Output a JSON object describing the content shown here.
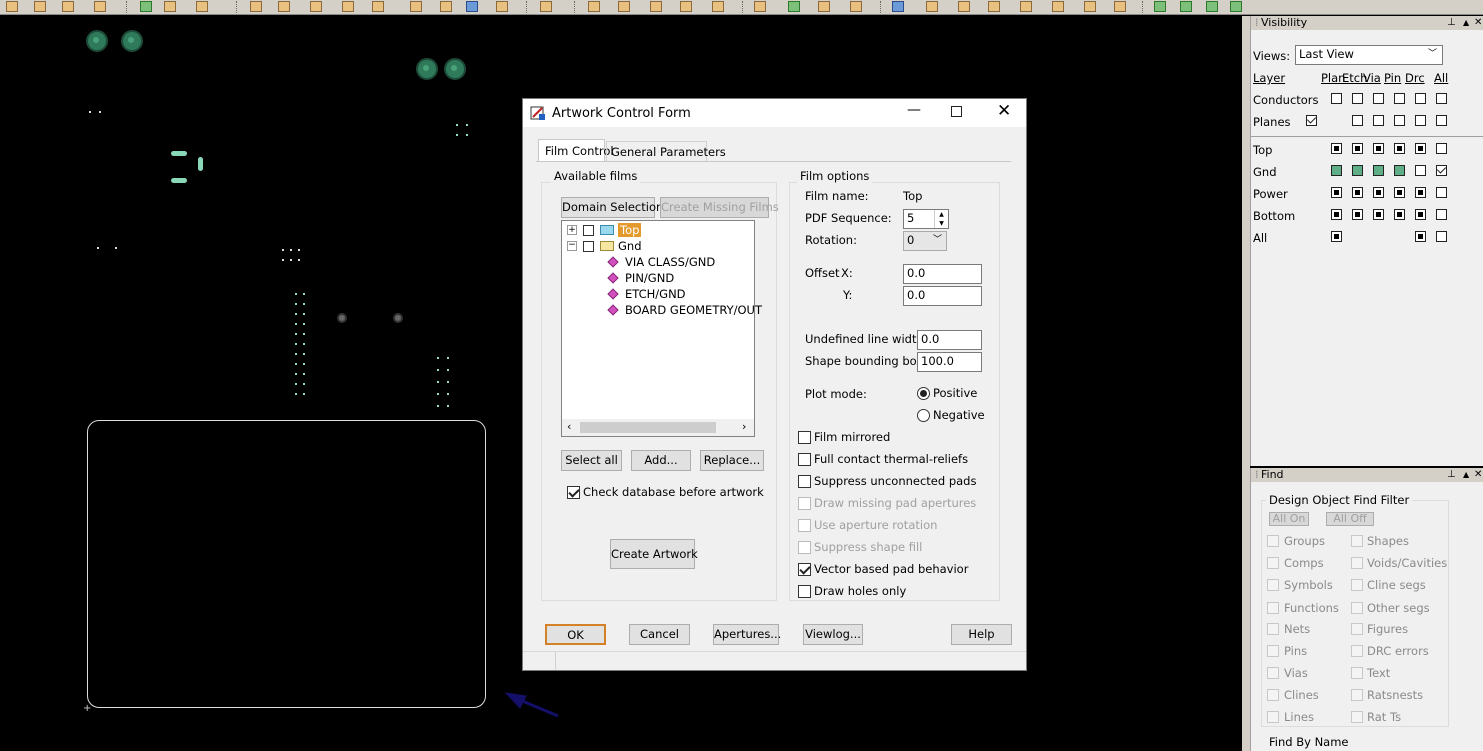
{
  "dialog": {
    "title": "Artwork Control Form",
    "tabs": [
      "Film Control",
      "General Parameters"
    ],
    "available_films_label": "Available films",
    "domain_selection": "Domain Selection",
    "create_missing_films": "Create Missing Films",
    "tree": {
      "top": "Top",
      "gnd": "Gnd",
      "gnd_children": [
        "VIA CLASS/GND",
        "PIN/GND",
        "ETCH/GND",
        "BOARD GEOMETRY/OUT"
      ]
    },
    "select_all": "Select all",
    "add": "Add...",
    "replace": "Replace...",
    "check_database": "Check database before artwork",
    "create_artwork": "Create Artwork",
    "film_options_label": "Film options",
    "film_name_label": "Film name:",
    "film_name_value": "Top",
    "pdf_sequence_label": "PDF Sequence:",
    "pdf_sequence_value": "5",
    "rotation_label": "Rotation:",
    "rotation_value": "0",
    "offset_label": "Offset",
    "offset_x_label": "X:",
    "offset_x_value": "0.0",
    "offset_y_label": "Y:",
    "offset_y_value": "0.0",
    "undefined_line_width_label": "Undefined line width:",
    "undefined_line_width_value": "0.0",
    "shape_bounding_box_label": "Shape bounding box:",
    "shape_bounding_box_value": "100.0",
    "plot_mode_label": "Plot mode:",
    "plot_positive": "Positive",
    "plot_negative": "Negative",
    "options": {
      "film_mirrored": "Film mirrored",
      "full_contact": "Full contact thermal-reliefs",
      "suppress_unconnected": "Suppress unconnected pads",
      "draw_missing": "Draw missing pad apertures",
      "use_aperture_rotation": "Use aperture rotation",
      "suppress_shape_fill": "Suppress shape fill",
      "vector_based": "Vector based pad behavior",
      "draw_holes_only": "Draw holes only"
    },
    "ok": "OK",
    "cancel": "Cancel",
    "apertures": "Apertures...",
    "viewlog": "Viewlog...",
    "help": "Help"
  },
  "visibility": {
    "title": "Visibility",
    "views_label": "Views:",
    "views_value": "Last View",
    "layer_header": "Layer",
    "columns": [
      "Plan",
      "Etch",
      "Via",
      "Pin",
      "Drc",
      "All"
    ],
    "rows1": [
      "Conductors",
      "Planes"
    ],
    "rows2": [
      "Top",
      "Gnd",
      "Power",
      "Bottom",
      "All"
    ]
  },
  "find": {
    "title": "Find",
    "filter_label": "Design Object Find Filter",
    "all_on": "All On",
    "all_off": "All Off",
    "left": [
      "Groups",
      "Comps",
      "Symbols",
      "Functions",
      "Nets",
      "Pins",
      "Vias",
      "Clines",
      "Lines"
    ],
    "right": [
      "Shapes",
      "Voids/Cavities",
      "Cline segs",
      "Other segs",
      "Figures",
      "DRC errors",
      "Text",
      "Ratsnests",
      "Rat Ts"
    ],
    "find_by_name": "Find By Name"
  }
}
